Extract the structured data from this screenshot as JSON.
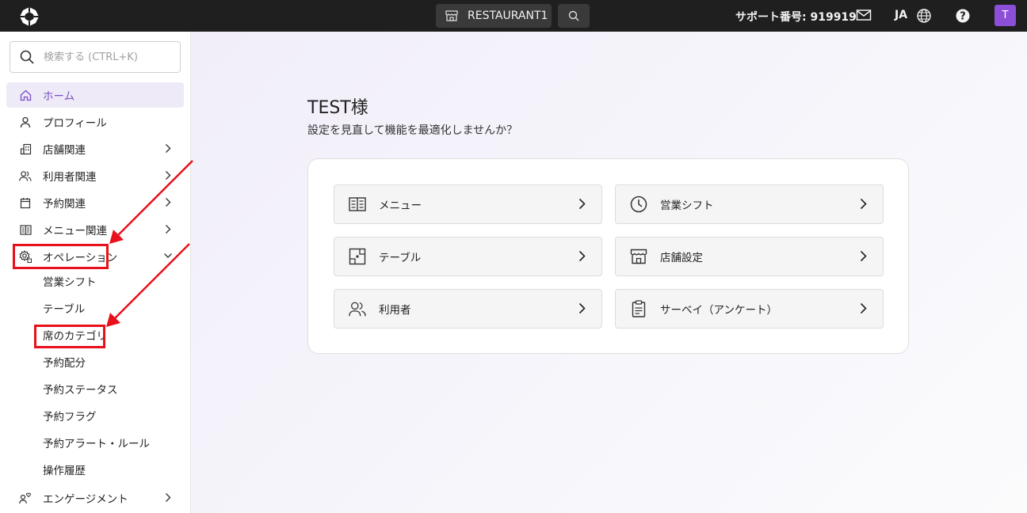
{
  "topbar": {
    "logo_icon": "app-logo-icon",
    "restaurant_label": "RESTAURANT1",
    "support_text": "サポート番号: 919919",
    "language": "JA",
    "avatar_initial": "T"
  },
  "sidebar": {
    "search_placeholder": "検索する (CTRL+K)",
    "items": [
      {
        "label": "ホーム",
        "icon": "home-icon",
        "active": true
      },
      {
        "label": "プロフィール",
        "icon": "person-icon"
      },
      {
        "label": "店舗関連",
        "icon": "building-icon",
        "chevron": "right"
      },
      {
        "label": "利用者関連",
        "icon": "users-icon",
        "chevron": "right"
      },
      {
        "label": "予約関連",
        "icon": "calendar-icon",
        "chevron": "right"
      },
      {
        "label": "メニュー関連",
        "icon": "menu-book-icon",
        "chevron": "right"
      },
      {
        "label": "オペレーション",
        "icon": "settings-gear-icon",
        "chevron": "down"
      },
      {
        "label": "エンゲージメント",
        "icon": "engagement-icon",
        "chevron": "right"
      }
    ],
    "sub_items": [
      "営業シフト",
      "テーブル",
      "席のカテゴリ",
      "予約配分",
      "予約ステータス",
      "予約フラグ",
      "予約アラート・ルール",
      "操作履歴"
    ]
  },
  "main": {
    "greeting": "TEST様",
    "subtitle": "設定を見直して機能を最適化しませんか？",
    "tiles": [
      {
        "label": "メニュー",
        "icon": "menu-book-icon"
      },
      {
        "label": "営業シフト",
        "icon": "clock-icon"
      },
      {
        "label": "テーブル",
        "icon": "table-icon"
      },
      {
        "label": "店舗設定",
        "icon": "store-icon"
      },
      {
        "label": "利用者",
        "icon": "users-icon"
      },
      {
        "label": "サーベイ（アンケート）",
        "icon": "clipboard-icon"
      }
    ]
  },
  "colors": {
    "topbar_bg": "#1f1f1f",
    "accent": "#7a4bc4",
    "avatar": "#8c4fd8",
    "highlight": "#e8101a"
  }
}
